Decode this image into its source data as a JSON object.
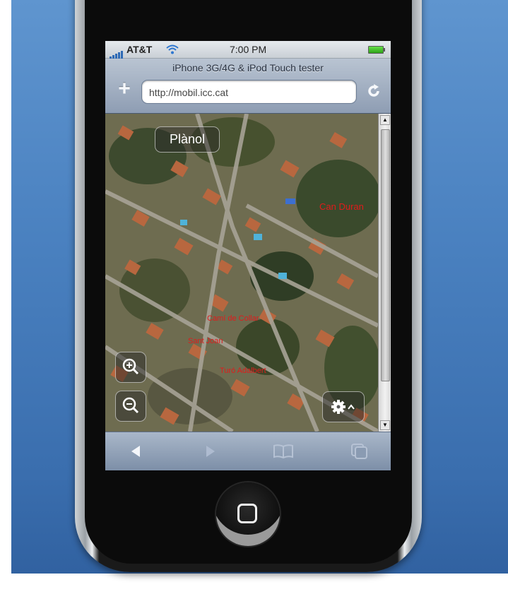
{
  "status_bar": {
    "carrier": "AT&T",
    "time": "7:00 PM",
    "wifi_icon": "wifi-icon",
    "battery_icon": "battery-icon"
  },
  "browser": {
    "title": "iPhone 3G/4G & iPod Touch tester",
    "url": "http://mobil.icc.cat",
    "add_icon": "plus-icon",
    "reload_icon": "reload-icon"
  },
  "map": {
    "mode_label": "Plànol",
    "labels": [
      "Can Duran",
      "Camí de Collar",
      "Sant Joan",
      "Turó Adalbert"
    ],
    "zoom_in_icon": "zoom-in-icon",
    "zoom_out_icon": "zoom-out-icon",
    "settings_icon": "gear-icon"
  },
  "bottom_toolbar": {
    "back_icon": "back-arrow-icon",
    "forward_icon": "forward-arrow-icon",
    "bookmarks_icon": "bookmarks-icon",
    "pages_icon": "pages-icon"
  },
  "colors": {
    "background": "#4a81c0",
    "map_label": "#e01b1b"
  }
}
